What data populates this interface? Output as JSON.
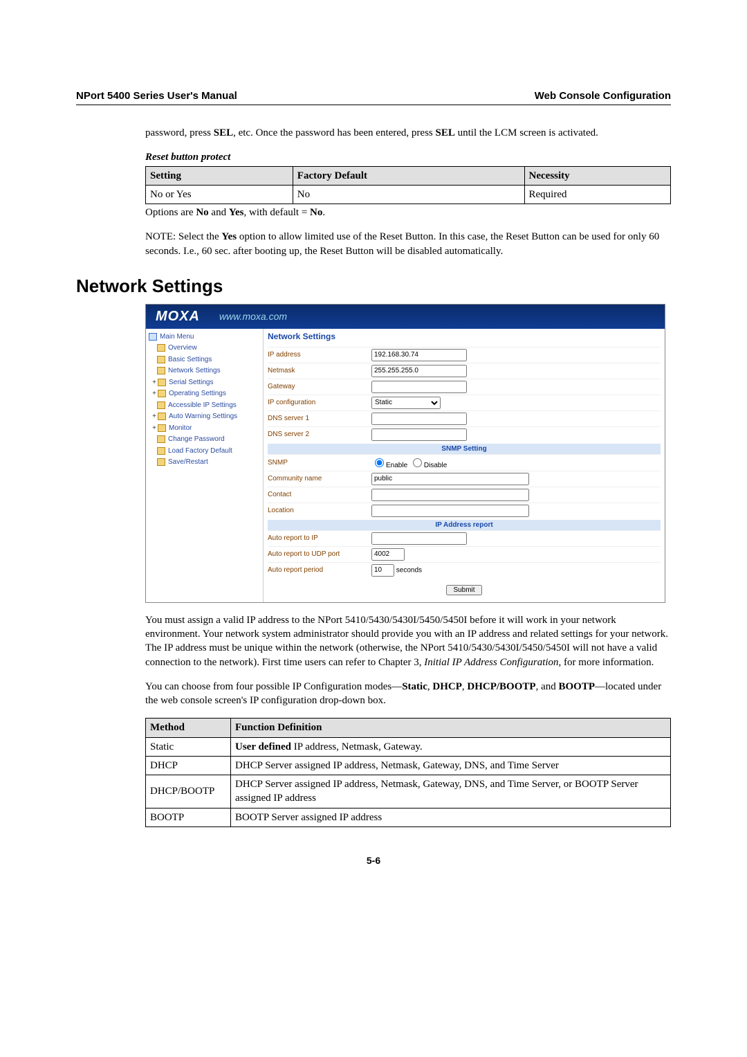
{
  "header": {
    "left": "NPort 5400 Series User's Manual",
    "right": "Web Console Configuration"
  },
  "para1_pre": "password, press ",
  "para1_sel1": "SEL",
  "para1_mid": ", etc. Once the password has been entered, press ",
  "para1_sel2": "SEL",
  "para1_post": " until the LCM screen is activated.",
  "reset_heading": "Reset button protect",
  "table1": {
    "h1": "Setting",
    "h2": "Factory Default",
    "h3": "Necessity",
    "c1": "No or Yes",
    "c2": "No",
    "c3": "Required"
  },
  "options_line_pre": "Options are ",
  "options_no": "No",
  "options_and": " and ",
  "options_yes": "Yes",
  "options_with": ", with default = ",
  "options_no2": "No",
  "options_dot": ".",
  "note_pre": "NOTE: Select the ",
  "note_yes": "Yes",
  "note_post": " option to allow limited use of the Reset Button. In this case, the Reset Button can be used for only 60 seconds. I.e., 60 sec. after booting up, the Reset Button will be disabled automatically.",
  "section_heading": "Network Settings",
  "moxa": {
    "logo": "MOXA",
    "url": "www.moxa.com"
  },
  "nav": {
    "main": "Main Menu",
    "overview": "Overview",
    "basic": "Basic Settings",
    "network": "Network Settings",
    "serial": "Serial Settings",
    "operating": "Operating Settings",
    "accessible": "Accessible IP Settings",
    "autowarn": "Auto Warning Settings",
    "monitor": "Monitor",
    "changepw": "Change Password",
    "loadfac": "Load Factory Default",
    "saverestart": "Save/Restart"
  },
  "content_title": "Network Settings",
  "rows": {
    "ip": {
      "label": "IP address",
      "value": "192.168.30.74"
    },
    "netmask": {
      "label": "Netmask",
      "value": "255.255.255.0"
    },
    "gateway": {
      "label": "Gateway",
      "value": ""
    },
    "ipconfig": {
      "label": "IP configuration",
      "value": "Static"
    },
    "dns1": {
      "label": "DNS server 1",
      "value": ""
    },
    "dns2": {
      "label": "DNS server 2",
      "value": ""
    }
  },
  "snmp_section": "SNMP Setting",
  "snmp": {
    "label": "SNMP",
    "enable": "Enable",
    "disable": "Disable"
  },
  "community": {
    "label": "Community name",
    "value": "public"
  },
  "contact": {
    "label": "Contact",
    "value": ""
  },
  "location": {
    "label": "Location",
    "value": ""
  },
  "ipreport_section": "IP Address report",
  "autoip": {
    "label": "Auto report to IP",
    "value": ""
  },
  "autoudp": {
    "label": "Auto report to UDP port",
    "value": "4002"
  },
  "autoperiod": {
    "label": "Auto report period",
    "value": "10",
    "unit": "seconds"
  },
  "submit": "Submit",
  "big_para_pre": "You must assign a valid IP address to the NPort 5410/5430/5430I/5450/5450I before it will work in your network environment. Your network system administrator should provide you with an IP address and related settings for your network. The IP address must be unique within the network (otherwise, the NPort 5410/5430/5430I/5450/5450I will not have a valid connection to the network). First time users can refer to Chapter 3, ",
  "big_para_italic": "Initial IP Address Configuration",
  "big_para_post": ", for more information.",
  "modes_para_a": "You can choose from four possible IP Configuration modes—",
  "modes_static": "Static",
  "modes_sep1": ", ",
  "modes_dhcp": "DHCP",
  "modes_sep2": ", ",
  "modes_dhcpbootp": "DHCP/BOOTP",
  "modes_sep3": ", and ",
  "modes_bootp": "BOOTP",
  "modes_para_b": "—located under the web console screen's IP configuration drop-down box.",
  "table2": {
    "h1": "Method",
    "h2": "Function Definition",
    "r1c1": "Static",
    "r1c2a": "User defined",
    "r1c2b": " IP address, Netmask, Gateway.",
    "r2c1": "DHCP",
    "r2c2": "DHCP Server assigned IP address, Netmask, Gateway, DNS, and Time Server",
    "r3c1": "DHCP/BOOTP",
    "r3c2": "DHCP Server assigned IP address, Netmask, Gateway, DNS, and Time Server, or BOOTP Server assigned IP address",
    "r4c1": "BOOTP",
    "r4c2": "BOOTP Server assigned IP address"
  },
  "page_num": "5-6"
}
